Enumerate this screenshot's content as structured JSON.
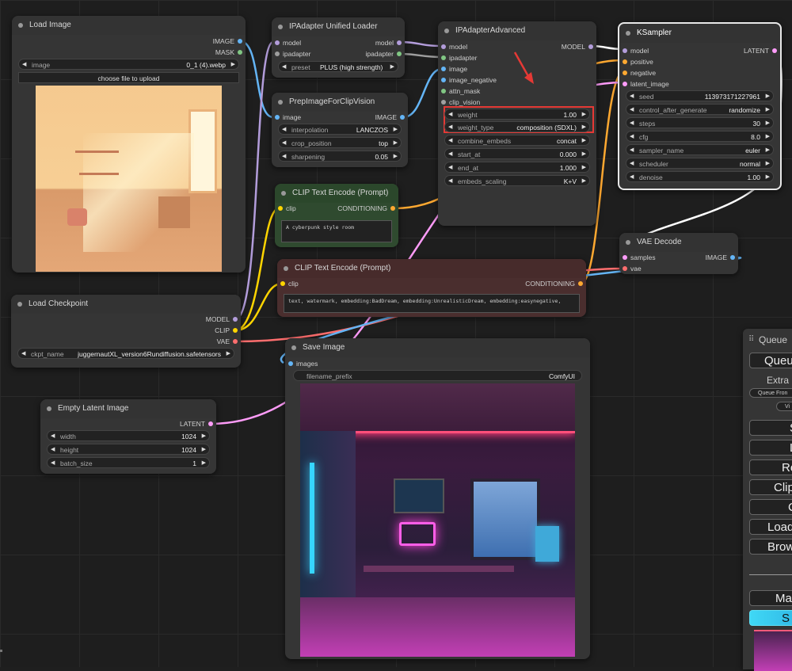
{
  "nodes": {
    "load_image": {
      "title": "Load Image",
      "out_image": "IMAGE",
      "out_mask": "MASK",
      "image_label": "image",
      "image_value": "0_1 (4).webp",
      "upload": "choose file to upload"
    },
    "ipa_loader": {
      "title": "IPAdapter Unified Loader",
      "in_model": "model",
      "in_ipadapter": "ipadapter",
      "out_model": "model",
      "out_ipadapter": "ipadapter",
      "preset_label": "preset",
      "preset_value": "PLUS (high strength)"
    },
    "prep": {
      "title": "PrepImageForClipVision",
      "in_image": "image",
      "out_image": "IMAGE",
      "interp_label": "interpolation",
      "interp_value": "LANCZOS",
      "crop_label": "crop_position",
      "crop_value": "top",
      "sharp_label": "sharpening",
      "sharp_value": "0.05"
    },
    "ipa_adv": {
      "title": "IPAdapterAdvanced",
      "in_model": "model",
      "in_ipadapter": "ipadapter",
      "in_image": "image",
      "in_image_negative": "image_negative",
      "in_attn_mask": "attn_mask",
      "in_clip_vision": "clip_vision",
      "out_model": "MODEL",
      "widgets": [
        {
          "l": "weight",
          "v": "1.00"
        },
        {
          "l": "weight_type",
          "v": "composition (SDXL)"
        },
        {
          "l": "combine_embeds",
          "v": "concat"
        },
        {
          "l": "start_at",
          "v": "0.000"
        },
        {
          "l": "end_at",
          "v": "1.000"
        },
        {
          "l": "embeds_scaling",
          "v": "K+V"
        }
      ]
    },
    "ksampler": {
      "title": "KSampler",
      "in_model": "model",
      "in_positive": "positive",
      "in_negative": "negative",
      "in_latent": "latent_image",
      "out_latent": "LATENT",
      "widgets": [
        {
          "l": "seed",
          "v": "113973171227961"
        },
        {
          "l": "control_after_generate",
          "v": "randomize"
        },
        {
          "l": "steps",
          "v": "30"
        },
        {
          "l": "cfg",
          "v": "8.0"
        },
        {
          "l": "sampler_name",
          "v": "euler"
        },
        {
          "l": "scheduler",
          "v": "normal"
        },
        {
          "l": "denoise",
          "v": "1.00"
        }
      ]
    },
    "clip_pos": {
      "title": "CLIP Text Encode (Prompt)",
      "in_clip": "clip",
      "out_cond": "CONDITIONING",
      "text": "A cyberpunk style room"
    },
    "clip_neg": {
      "title": "CLIP Text Encode (Prompt)",
      "in_clip": "clip",
      "out_cond": "CONDITIONING",
      "text": "text, watermark, embedding:BadDream, embedding:UnrealisticDream, embedding:easynegative,"
    },
    "vae_decode": {
      "title": "VAE Decode",
      "in_samples": "samples",
      "in_vae": "vae",
      "out_image": "IMAGE"
    },
    "checkpoint": {
      "title": "Load Checkpoint",
      "out_model": "MODEL",
      "out_clip": "CLIP",
      "out_vae": "VAE",
      "ckpt_label": "ckpt_name",
      "ckpt_value": "juggernautXL_version6Rundiffusion.safetensors"
    },
    "save_image": {
      "title": "Save Image",
      "in_images": "images",
      "prefix_label": "filename_prefix",
      "prefix_value": "ComfyUI"
    },
    "empty_latent": {
      "title": "Empty Latent Image",
      "out_latent": "LATENT",
      "width_label": "width",
      "width_value": "1024",
      "height_label": "height",
      "height_value": "1024",
      "batch_label": "batch_size",
      "batch_value": "1"
    }
  },
  "side_panel": {
    "title": "Queue",
    "queue_btn": "Queue",
    "extra": "Extra",
    "queue_front": "Queue Fron",
    "view": "Vi",
    "b1": "S",
    "b2": "L",
    "b3": "Re",
    "b4": "Clip",
    "b5": "C",
    "b6": "Load",
    "b7": "Brow",
    "manager": "Ma",
    "share": "S"
  },
  "colors": {
    "model": "#b39ddb",
    "image": "#64b5f6",
    "clip": "#ffd500",
    "vae": "#ff6e6e",
    "conditioning": "#ffa931",
    "latent": "#ff9cf9",
    "highlight": "#e53935"
  }
}
